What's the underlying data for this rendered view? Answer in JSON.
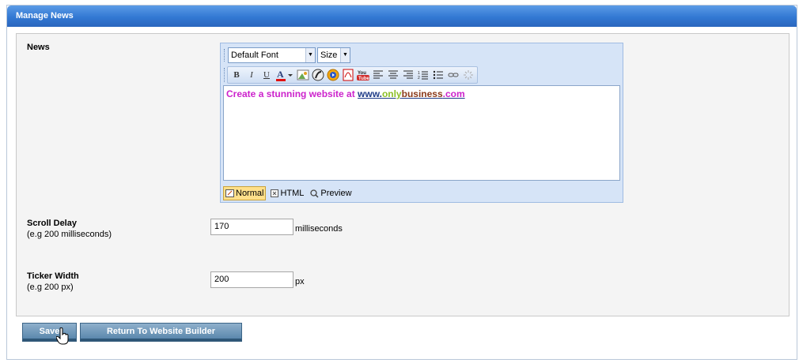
{
  "panel": {
    "title": "Manage News"
  },
  "news": {
    "label": "News",
    "font_select": "Default Font",
    "size_select": "Size",
    "content_prefix": "Create a stunning website at ",
    "content_www": "www.",
    "content_only": "only",
    "content_business": "business",
    "content_com": ".com",
    "modes": {
      "normal": "Normal",
      "html": "HTML",
      "preview": "Preview"
    }
  },
  "scroll_delay": {
    "label": "Scroll Delay",
    "hint": "(e.g 200 milliseconds)",
    "value": "170",
    "unit": "milliseconds"
  },
  "ticker_width": {
    "label": "Ticker Width",
    "hint": "(e.g 200 px)",
    "value": "200",
    "unit": "px"
  },
  "buttons": {
    "save": "Save",
    "return": "Return To Website Builder"
  },
  "colors": {
    "header": "#3278d3",
    "link_pink": "#cc22cc",
    "link_green": "#8cbf26",
    "link_brown": "#8b3a1a",
    "link_blue": "#1f3c88"
  }
}
